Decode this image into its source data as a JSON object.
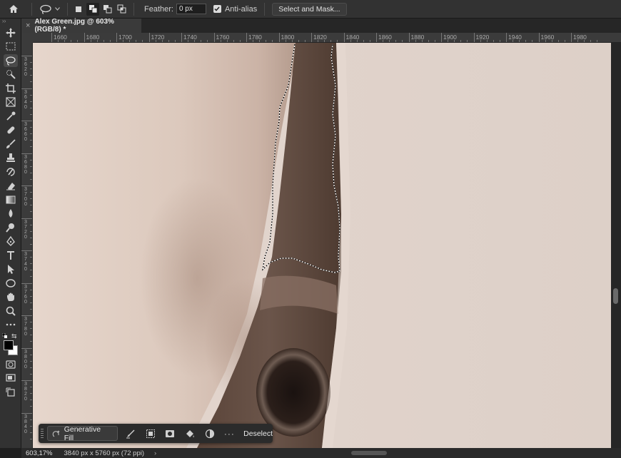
{
  "options_bar": {
    "feather_label": "Feather:",
    "feather_value": "0 px",
    "anti_alias_label": "Anti-alias",
    "select_and_mask_label": "Select and Mask..."
  },
  "document": {
    "tab_title": "Alex Green.jpg @ 603% (RGB/8) *",
    "close_symbol": "×"
  },
  "ruler": {
    "horizontal_labels": [
      "1660",
      "1680",
      "1700",
      "1720",
      "1740",
      "1760",
      "1780",
      "1800",
      "1820",
      "1840",
      "1860",
      "1880",
      "1900",
      "1920",
      "1940",
      "1960",
      "1980"
    ],
    "vertical_labels": [
      "3620",
      "3640",
      "3660",
      "3680",
      "3700",
      "3720",
      "3740",
      "3760",
      "3780",
      "3800",
      "3820",
      "3840"
    ]
  },
  "taskbar": {
    "generative_fill_label": "Generative Fill",
    "more_label": "···",
    "deselect_label": "Deselect"
  },
  "status": {
    "zoom": "603,17%",
    "doc_info": "3840 px x 5760 px (72 ppi)",
    "arrow": "›"
  },
  "colors": {
    "foreground": "#000000",
    "background": "#ffffff"
  }
}
